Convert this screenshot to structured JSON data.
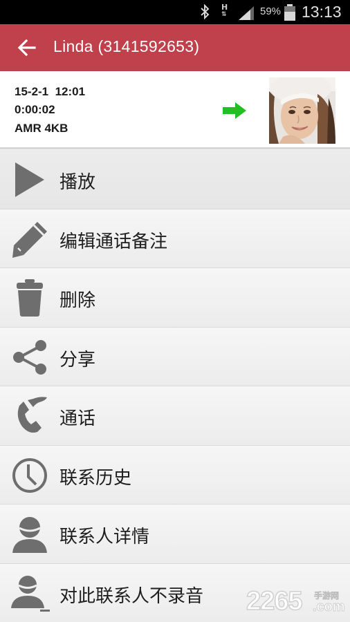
{
  "status_bar": {
    "network": "H",
    "battery_percent": "59%",
    "time": "13:13",
    "signal_level": 0.75
  },
  "app_bar": {
    "title": "Linda (3141592653)"
  },
  "recording": {
    "date_time": "15-2-1  12:01",
    "duration": "0:00:02",
    "format_size": "AMR 4KB",
    "direction_color": "#20c020"
  },
  "menu": [
    {
      "icon": "play-icon",
      "label": "播放"
    },
    {
      "icon": "pencil-icon",
      "label": "编辑通话备注"
    },
    {
      "icon": "trash-icon",
      "label": "删除"
    },
    {
      "icon": "share-icon",
      "label": "分享"
    },
    {
      "icon": "phone-icon",
      "label": "通话"
    },
    {
      "icon": "clock-icon",
      "label": "联系历史"
    },
    {
      "icon": "person-icon",
      "label": "联系人详情"
    },
    {
      "icon": "person-mute-icon",
      "label": "对此联系人不录音"
    }
  ],
  "watermark": {
    "brand": "2265",
    "suffix": ".com",
    "site": "手游网"
  },
  "colors": {
    "app_bar": "#c0414b",
    "icon_gray": "#6e6e6e"
  }
}
